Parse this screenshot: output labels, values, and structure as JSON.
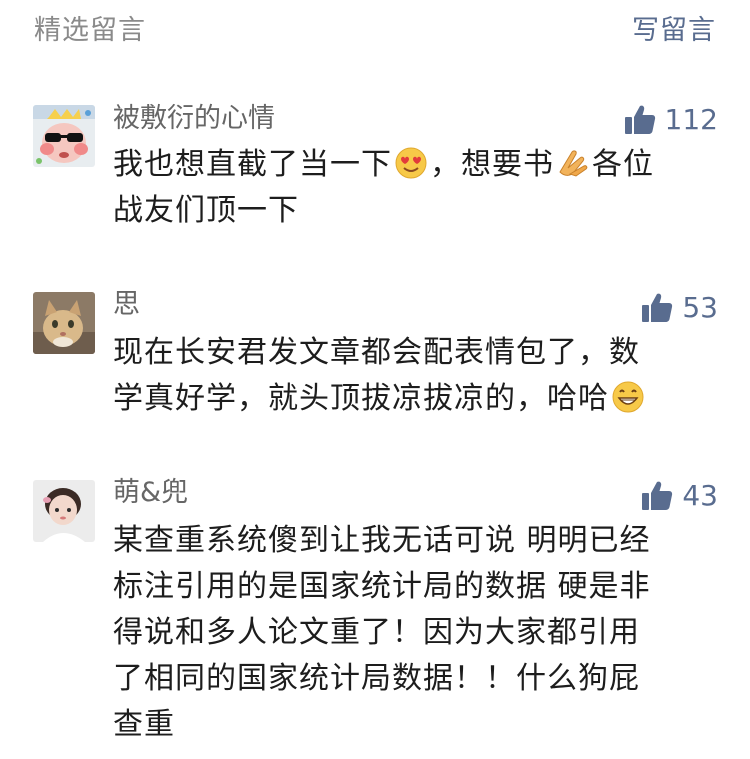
{
  "header": {
    "title": "精选留言",
    "write_label": "写留言"
  },
  "colors": {
    "link_blue": "#596c8f",
    "gray_text": "#8a8a8a"
  },
  "comments": [
    {
      "nickname": "被敷衍的心情",
      "likes": "112",
      "text_parts": [
        "我也想直截了当一下",
        "，想要书",
        "各位",
        "战友们顶一下"
      ],
      "emojis": [
        "heart-eyes-emoji",
        "clap-hands-emoji"
      ]
    },
    {
      "nickname": "思",
      "likes": "53",
      "text_parts": [
        "现在长安君发文章都会配表情包了，数",
        "学真好学，就头顶拔凉拔凉的，哈哈"
      ],
      "emojis": [
        "grin-emoji"
      ]
    },
    {
      "nickname": "萌&兜",
      "likes": "43",
      "text_lines": [
        "某查重系统傻到让我无话可说 明明已经",
        "标注引用的是国家统计局的数据 硬是非",
        "得说和多人论文重了！因为大家都引用",
        "了相同的国家统计局数据！！什么狗屁",
        "查重"
      ]
    }
  ]
}
